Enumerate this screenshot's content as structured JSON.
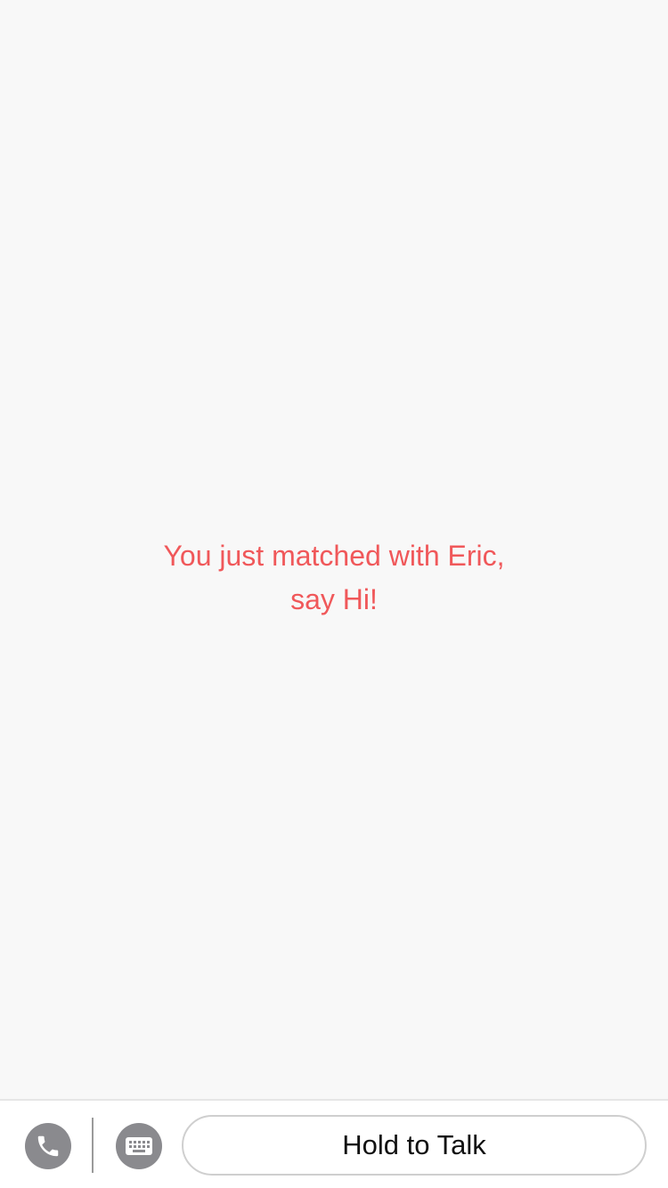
{
  "chat": {
    "match_message": {
      "line1": "You just matched with Eric,",
      "line2": "say Hi!"
    }
  },
  "input_bar": {
    "call_icon": "phone-icon",
    "keyboard_icon": "keyboard-icon",
    "hold_to_talk_label": "Hold to Talk"
  },
  "colors": {
    "accent": "#f0585a",
    "icon_bg": "#8a8a8e",
    "background": "#f8f8f8"
  }
}
